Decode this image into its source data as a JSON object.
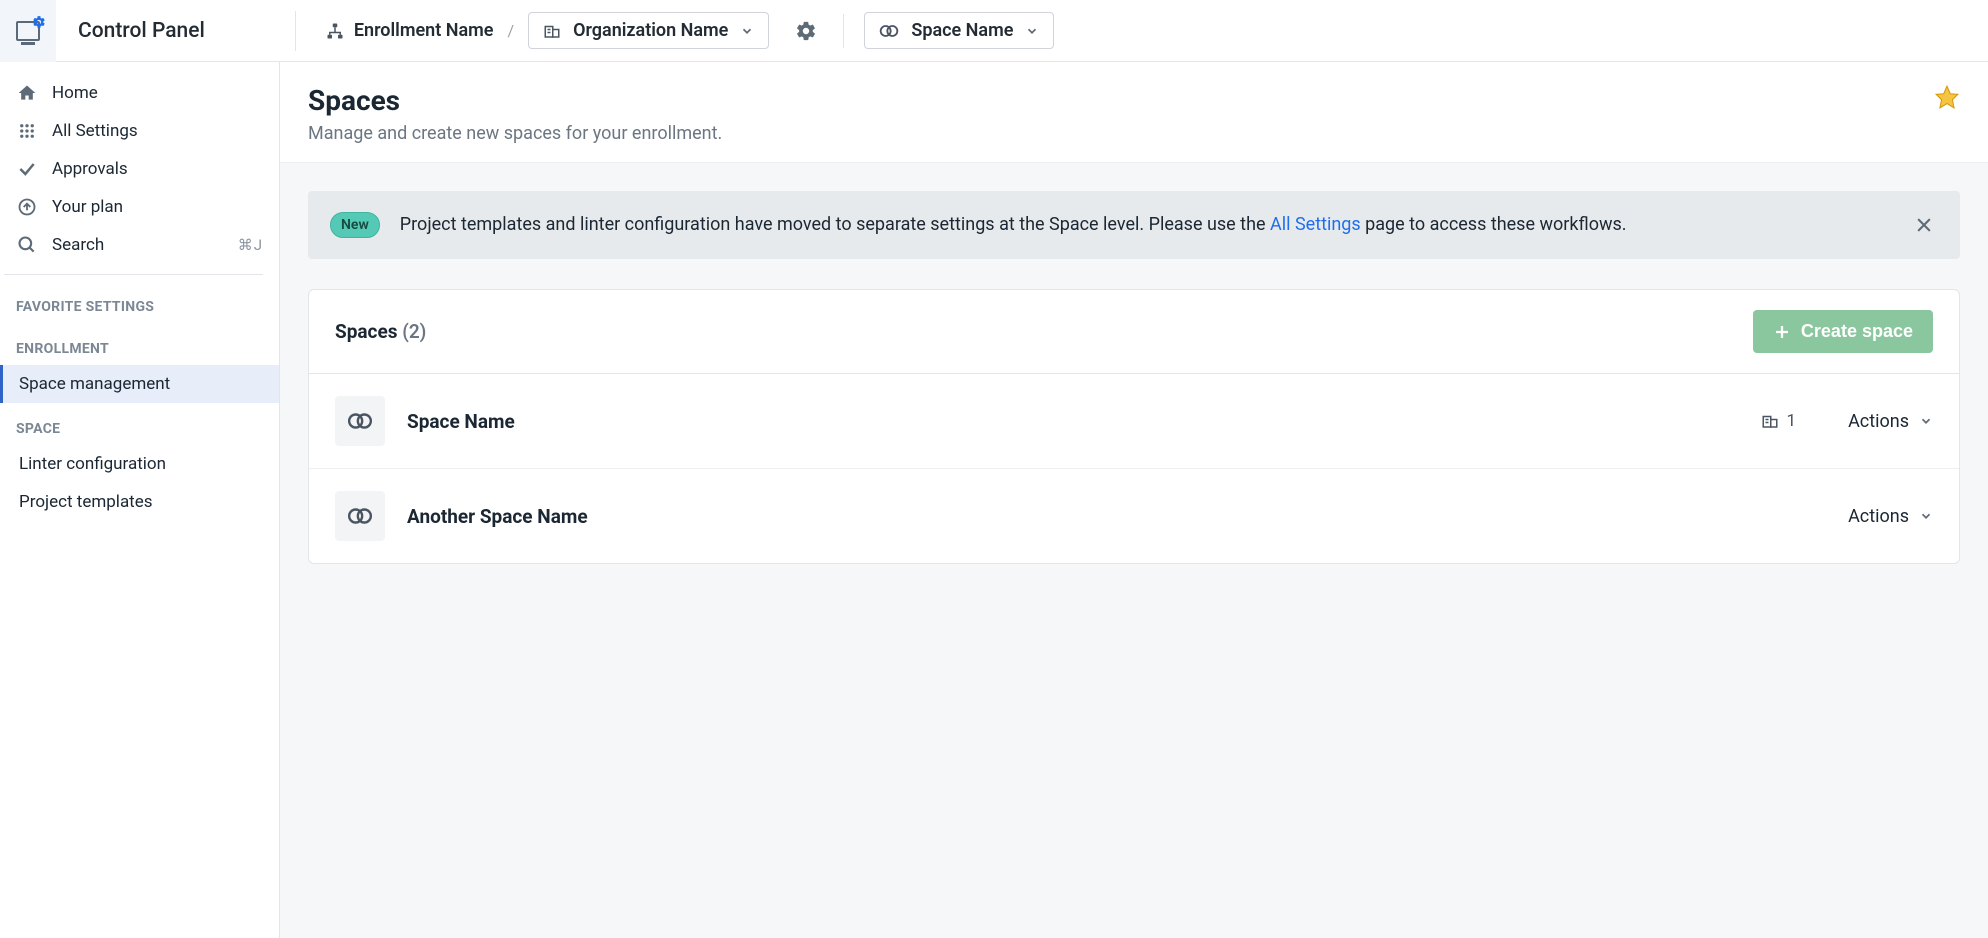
{
  "app_title": "Control Panel",
  "breadcrumb": {
    "enrollment": "Enrollment Name",
    "organization": "Organization Name",
    "space": "Space Name"
  },
  "sidebar": {
    "primary": [
      {
        "label": "Home",
        "icon": "home"
      },
      {
        "label": "All Settings",
        "icon": "grid"
      },
      {
        "label": "Approvals",
        "icon": "check"
      },
      {
        "label": "Your plan",
        "icon": "arrow-up-circle"
      },
      {
        "label": "Search",
        "icon": "search",
        "kbd": "⌘J"
      }
    ],
    "sections": [
      {
        "heading": "FAVORITE SETTINGS",
        "items": []
      },
      {
        "heading": "ENROLLMENT",
        "items": [
          {
            "label": "Space management",
            "active": true
          }
        ]
      },
      {
        "heading": "SPACE",
        "items": [
          {
            "label": "Linter configuration"
          },
          {
            "label": "Project templates"
          }
        ]
      }
    ]
  },
  "page": {
    "title": "Spaces",
    "subtitle": "Manage and create new spaces for your enrollment."
  },
  "notice": {
    "badge": "New",
    "text_before": "Project templates and linter configuration have moved to separate settings at the Space level. Please use the ",
    "link_text": "All Settings",
    "text_after": " page to access these workflows."
  },
  "panel": {
    "title": "Spaces",
    "count_display": "(2)",
    "create_label": "Create space",
    "actions_label": "Actions",
    "rows": [
      {
        "name": "Space Name",
        "org_count": "1"
      },
      {
        "name": "Another Space Name"
      }
    ]
  }
}
